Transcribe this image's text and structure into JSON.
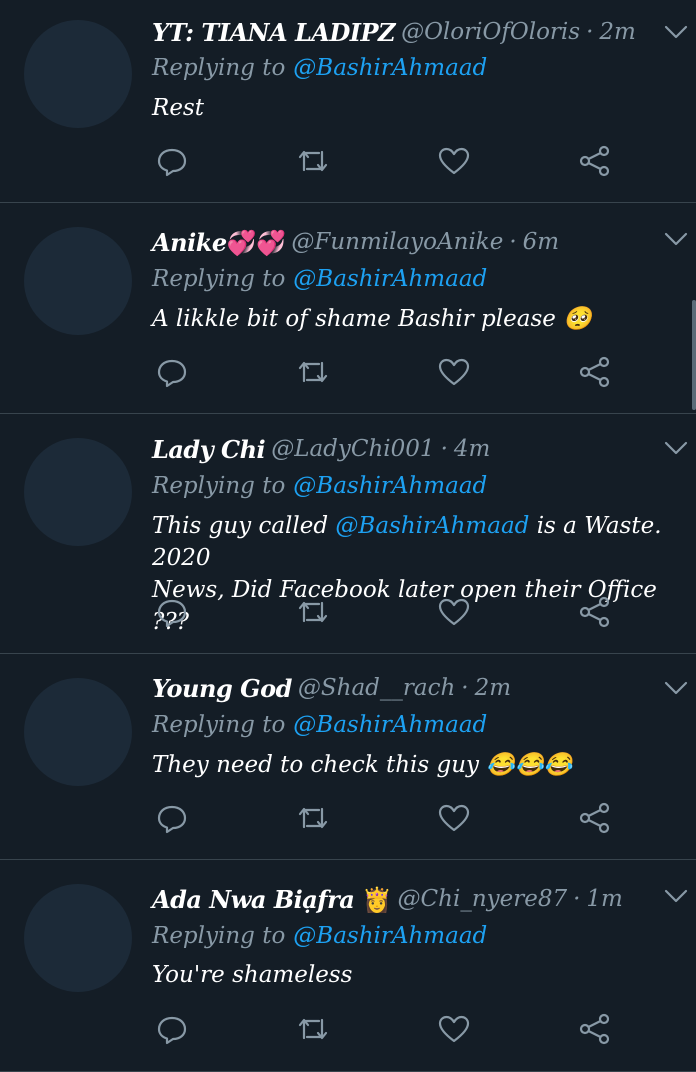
{
  "replying_to_label": "Replying to",
  "tweets": [
    {
      "name": "YT: TIANA LADIPZ",
      "handle": "@OloriOfOloris",
      "time": "2m",
      "mention": "@BashirAhmaad",
      "body_lines": [
        "Rest"
      ]
    },
    {
      "name": "Anike",
      "name_emoji": "💞💞",
      "handle": "@FunmilayoAnike",
      "time": "6m",
      "mention": "@BashirAhmaad",
      "body_lines": [
        "A likkle bit of shame Bashir please 🥺"
      ]
    },
    {
      "name": "Lady Chi",
      "handle": "@LadyChi001",
      "time": "4m",
      "mention": "@BashirAhmaad",
      "body_mention": "@BashirAhmaad",
      "body_pre": "This guy called",
      "body_post": " is a Waste. 2020",
      "body_line2": "News, Did Facebook later open their Office ???"
    },
    {
      "name": "Young God",
      "handle": "@Shad__rach",
      "time": "2m",
      "mention": "@BashirAhmaad",
      "body_lines": [
        "They need to check this guy 😂😂😂"
      ]
    },
    {
      "name": "Ada Nwa Biạfra",
      "name_emoji": "👸",
      "handle": "@Chi_nyere87",
      "time": "1m",
      "mention": "@BashirAhmaad",
      "body_lines": [
        "You're shameless"
      ]
    }
  ],
  "colors": {
    "background": "#141d26",
    "muted": "#8899a6",
    "accent": "#1da1f2",
    "divider": "#38444d"
  },
  "icons": [
    "chevron-down-icon",
    "reply-icon",
    "retweet-icon",
    "like-icon",
    "share-icon"
  ]
}
